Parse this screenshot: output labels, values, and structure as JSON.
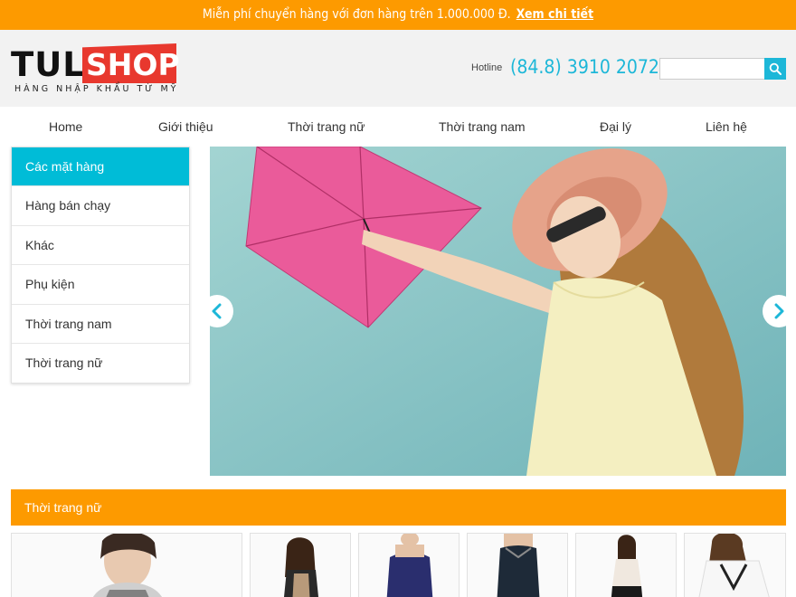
{
  "topbar": {
    "message": "Miễn phí chuyển hàng với đơn hàng trên 1.000.000 Đ.",
    "link_label": "Xem chi tiết"
  },
  "logo": {
    "part1": "TUL",
    "part2": "SHOP",
    "tagline": "HÀNG NHẬP KHẨU TỪ MỸ"
  },
  "header": {
    "hotline_label": "Hotline",
    "hotline_number": "(84.8) 3910 2072",
    "search_placeholder": ""
  },
  "nav": {
    "items": [
      {
        "label": "Home"
      },
      {
        "label": "Giới thiệu"
      },
      {
        "label": "Thời trang nữ"
      },
      {
        "label": "Thời trang nam"
      },
      {
        "label": "Đại lý"
      },
      {
        "label": "Liên hệ"
      }
    ]
  },
  "sidebar": {
    "title": "Các mặt hàng",
    "items": [
      {
        "label": "Hàng bán chạy"
      },
      {
        "label": "Khác"
      },
      {
        "label": "Phụ kiện"
      },
      {
        "label": "Thời trang nam"
      },
      {
        "label": "Thời trang nữ"
      }
    ]
  },
  "section": {
    "title": "Thời trang nữ"
  },
  "colors": {
    "accent_orange": "#fd9a00",
    "accent_cyan": "#00bcd7",
    "logo_red": "#e8382e"
  },
  "icons": {
    "search": "search-icon",
    "prev": "chevron-left-icon",
    "next": "chevron-right-icon"
  }
}
